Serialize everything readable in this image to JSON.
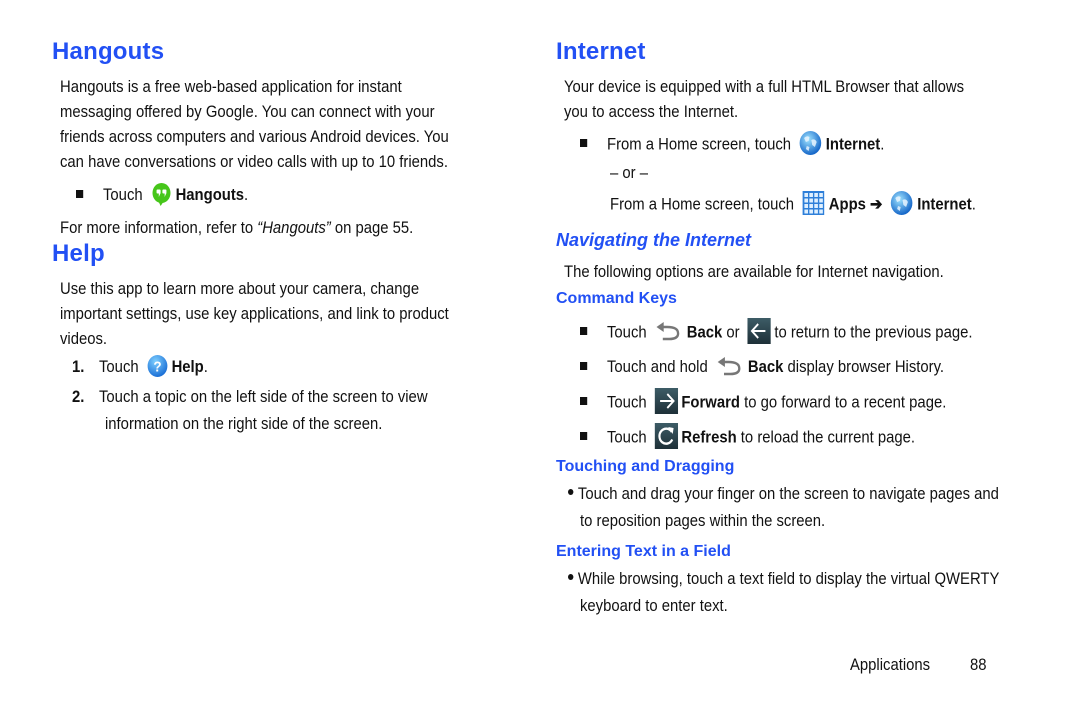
{
  "left": {
    "hangouts": {
      "title": "Hangouts",
      "body": [
        "Hangouts is a free web-based application for instant",
        "messaging offered by Google. You can connect with your",
        "friends across computers and various Android devices. You",
        "can have conversations or video calls with up to 10 friends."
      ],
      "step_touch": "Touch",
      "step_app": "Hangouts",
      "step_end": ".",
      "ref_pre": "For more information, refer to ",
      "ref_link": "“Hangouts”",
      "ref_post": " on page 55."
    },
    "help": {
      "title": "Help",
      "body": [
        "Use this app to learn more about your camera, change",
        "important settings, use key applications, and link to product",
        "videos."
      ],
      "steps": [
        {
          "num": "1.",
          "touch": "Touch",
          "app": "Help",
          "end": "."
        },
        {
          "num": "2.",
          "lines": [
            "Touch a topic on the left side of the screen to view",
            "information on the right side of the screen."
          ]
        }
      ]
    }
  },
  "right": {
    "internet": {
      "title": "Internet",
      "body": [
        "Your device is equipped with a full HTML Browser that allows",
        "you to access the Internet."
      ],
      "step1_pre": "From a Home screen, touch",
      "step1_app": "Internet",
      "or": "– or –",
      "step2_pre": "From a Home screen, touch",
      "step2_apps": "Apps",
      "step2_arrow": "➔",
      "step2_app": "Internet",
      "end": "."
    },
    "navigating": {
      "title": "Navigating the Internet",
      "body": "The following options are available for Internet navigation."
    },
    "command_keys": {
      "title": "Command Keys",
      "items": [
        {
          "pre": "Touch",
          "key": "Back",
          "mid": "or",
          "post": "to return to the previous page."
        },
        {
          "pre": "Touch and hold",
          "key": "Back",
          "post": "display browser History."
        },
        {
          "pre": "Touch",
          "key": "Forward",
          "post": "to go forward to a recent page."
        },
        {
          "pre": "Touch",
          "key": "Refresh",
          "post": "to reload the current page."
        }
      ]
    },
    "touching": {
      "title": "Touching and Dragging",
      "lines": [
        "Touch and drag your finger on the screen to navigate pages and",
        "to reposition pages within the screen."
      ]
    },
    "entering": {
      "title": "Entering Text in a Field",
      "lines": [
        "While browsing, touch a text field to display the virtual QWERTY",
        "keyboard to enter text."
      ]
    }
  },
  "footer": {
    "section": "Applications",
    "page": "88"
  },
  "colors": {
    "heading": "#2250f4",
    "text": "#111111"
  }
}
